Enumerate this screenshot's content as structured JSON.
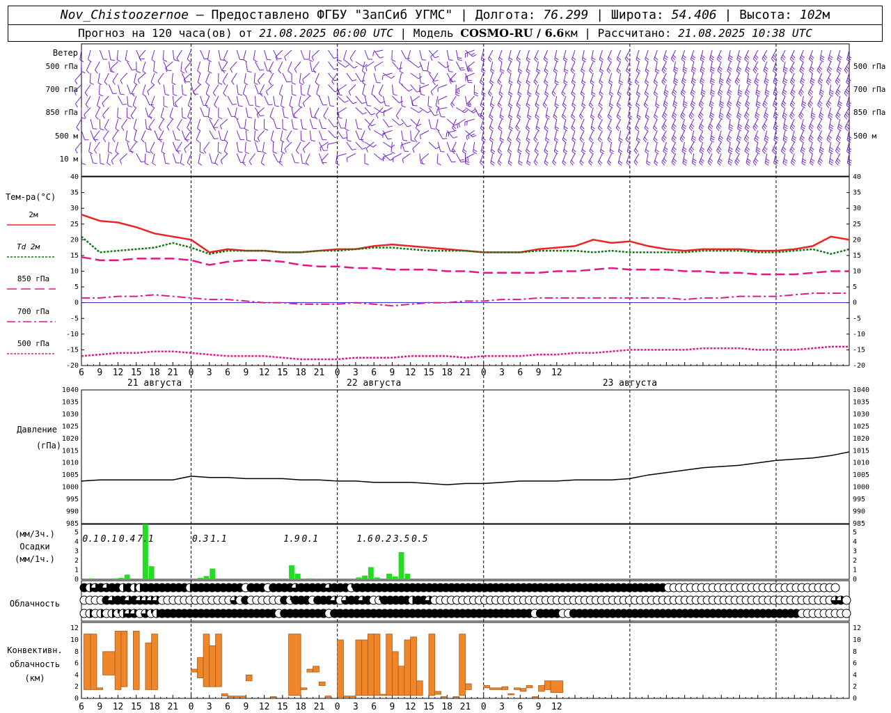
{
  "header": {
    "station": "Nov_Chistoozernoe",
    "provided_by": " – Предоставлено ФГБУ \"ЗапСиб УГМС\" | Долгота: ",
    "lon": "76.299",
    "lat_label": " | Широта: ",
    "lat": "54.406",
    "alt_label": " | Высота: ",
    "alt": "102",
    "alt_unit": "м",
    "forecast_label": "Прогноз на 120 часа(ов) от ",
    "init_time": "21.08.2025 06:00 UTC",
    "model_label": " | Модель ",
    "model": "COSMO-RU / 6.6",
    "model_unit": "км",
    "calc_label": " | Рассчитано: ",
    "calc_time": "21.08.2025 10:38 UTC"
  },
  "panels": {
    "wind": {
      "title": "Ветер",
      "levels": [
        "500 гПа",
        "700 гПа",
        "850 гПа",
        "500 м",
        "10  м"
      ]
    },
    "temp": {
      "title": "Тем-ра(°С)",
      "legend": [
        {
          "label": "2м",
          "color": "#ee2222"
        },
        {
          "label": "Td  2м",
          "color": "#117711"
        },
        {
          "label": "850 гПа",
          "color": "#e01888"
        },
        {
          "label": "700 гПа",
          "color": "#e01888"
        },
        {
          "label": "500 гПа",
          "color": "#e01888"
        }
      ],
      "ticks": [
        "40",
        "35",
        "30",
        "25",
        "20",
        "15",
        "10",
        "5",
        "0",
        "-5",
        "-10",
        "-15",
        "-20"
      ]
    },
    "pressure": {
      "title": "Давление",
      "unit": "(гПа)",
      "ticks": [
        "1040",
        "1035",
        "1030",
        "1025",
        "1020",
        "1015",
        "1010",
        "1005",
        "1000",
        "995",
        "990",
        "985"
      ]
    },
    "precip": {
      "unit_top": "(мм/3ч.)",
      "title": "Осадки",
      "unit_bottom": "(мм/1ч.)",
      "ticks": [
        "5",
        "4",
        "3",
        "2",
        "1",
        "0"
      ]
    },
    "cloud": {
      "title": "Облачность"
    },
    "conv": {
      "title_1": "Конвективн.",
      "title_2": "облачность",
      "title_3": "(км)",
      "ticks": [
        "12",
        "10",
        "8",
        "6",
        "4",
        "2",
        "0"
      ]
    }
  },
  "time_axis": {
    "hour_labels": [
      "6",
      "9",
      "12",
      "15",
      "18",
      "21",
      "0",
      "3",
      "6",
      "9",
      "12",
      "15",
      "18",
      "21",
      "0",
      "3",
      "6",
      "9",
      "12",
      "15",
      "18",
      "21",
      "0",
      "3",
      "6",
      "9",
      "12"
    ],
    "days": [
      "21 августа",
      "22 августа",
      "23 августа"
    ]
  },
  "colors": {
    "wind": "#7722cc",
    "t2m": "#ee2222",
    "td": "#117711",
    "upper": "#e01888",
    "zero": "#2222cc",
    "precip": "#22dd22",
    "conv": "#f0862a"
  },
  "chart_data": [
    {
      "type": "line",
      "name": "temperature",
      "x_hours": [
        0,
        3,
        6,
        9,
        12,
        15,
        18,
        21,
        24,
        27,
        30,
        33,
        36,
        39,
        42,
        45,
        48,
        51,
        54,
        57,
        60,
        63,
        66,
        69,
        72,
        75,
        78,
        81,
        84,
        87,
        90,
        93,
        96,
        99,
        102,
        105,
        108,
        111,
        114,
        117,
        120,
        123,
        126
      ],
      "ylim": [
        -20,
        40
      ],
      "series": [
        {
          "name": "2м",
          "values": [
            28,
            26,
            25.5,
            24,
            22,
            21,
            20,
            16,
            17,
            16.5,
            16.5,
            16,
            16,
            16.5,
            17,
            17,
            18,
            18.5,
            18,
            17.5,
            17,
            16.5,
            16,
            16,
            16,
            17,
            17.5,
            18,
            20,
            19,
            19.5,
            18,
            17,
            16.5,
            17,
            17,
            17,
            16.5,
            16.5,
            17,
            18,
            21,
            20
          ]
        },
        {
          "name": "Td  2м",
          "values": [
            21,
            16,
            16.5,
            17,
            17.5,
            19,
            17.5,
            15.5,
            16.5,
            16.5,
            16.5,
            16,
            16,
            16.5,
            16.5,
            17,
            17.5,
            17.5,
            17,
            16.5,
            16.5,
            16.5,
            16,
            16,
            16,
            16.5,
            16.5,
            16.5,
            16,
            16.5,
            16,
            16,
            16,
            16,
            16.5,
            16.5,
            16.5,
            16,
            16,
            16.5,
            17,
            15.5,
            17
          ]
        },
        {
          "name": "850 гПа",
          "values": [
            14.5,
            13.5,
            13.5,
            14,
            14,
            14,
            13.5,
            12,
            13,
            13.5,
            13.5,
            13,
            12,
            11.5,
            11.5,
            11,
            11,
            10.5,
            10.5,
            10.5,
            10,
            10,
            9.5,
            9.5,
            9.5,
            9.5,
            10,
            10,
            10.5,
            11,
            10.5,
            10.5,
            10.5,
            10,
            10,
            9.5,
            9.5,
            9,
            9,
            9,
            9.5,
            10,
            10
          ]
        },
        {
          "name": "700 гПа",
          "values": [
            1.5,
            1.5,
            2,
            2,
            2.5,
            2,
            1.5,
            1,
            1,
            0.5,
            0,
            0,
            -0.5,
            -0.5,
            -0.5,
            0,
            -0.5,
            -1,
            -0.5,
            0,
            0,
            0.5,
            0.5,
            1,
            1,
            1.5,
            1.5,
            1.5,
            1.5,
            1.5,
            1.5,
            1.5,
            1.5,
            1,
            1.5,
            1.5,
            2,
            2,
            2,
            2.5,
            3,
            3,
            3
          ]
        },
        {
          "name": "500 гПа",
          "values": [
            -17,
            -16.5,
            -16,
            -16,
            -15.5,
            -15.5,
            -16,
            -16.5,
            -17,
            -17,
            -17,
            -17.5,
            -18,
            -18,
            -18,
            -17.5,
            -17.5,
            -17.5,
            -17,
            -17,
            -17,
            -17.5,
            -17,
            -17,
            -17,
            -16.5,
            -16.5,
            -16,
            -16,
            -15.5,
            -15,
            -15,
            -15,
            -15,
            -14.5,
            -14.5,
            -14.5,
            -15,
            -15,
            -15,
            -14.5,
            -14,
            -14
          ]
        }
      ]
    },
    {
      "type": "line",
      "name": "pressure",
      "x_hours": [
        0,
        3,
        6,
        9,
        12,
        15,
        18,
        21,
        24,
        27,
        30,
        33,
        36,
        39,
        42,
        45,
        48,
        51,
        54,
        57,
        60,
        63,
        66,
        69,
        72,
        75,
        78,
        81,
        84,
        87,
        90,
        93,
        96,
        99,
        102,
        105,
        108,
        111,
        114,
        117,
        120,
        123,
        126
      ],
      "ylim": [
        985,
        1040
      ],
      "series": [
        {
          "name": "p",
          "values": [
            1002.5,
            1003,
            1003,
            1003,
            1003,
            1003,
            1004.5,
            1004,
            1004,
            1003.5,
            1003.5,
            1003.5,
            1003,
            1003,
            1002.5,
            1002.5,
            1002,
            1002,
            1002,
            1001.5,
            1001,
            1001.5,
            1001.5,
            1002,
            1002.5,
            1002.5,
            1002.5,
            1003,
            1003,
            1003,
            1003.5,
            1005,
            1006,
            1007,
            1008,
            1008.5,
            1009,
            1010,
            1011,
            1011.5,
            1012,
            1013,
            1014.5
          ]
        }
      ]
    },
    {
      "type": "bar",
      "name": "precipitation",
      "ylim": [
        0,
        5
      ],
      "hourly_bars": [
        {
          "hour": 1.5,
          "value": 0.1
        },
        {
          "hour": 5.5,
          "value": 0.1
        },
        {
          "hour": 6.5,
          "value": 0.15
        },
        {
          "hour": 7.5,
          "value": 0.5
        },
        {
          "hour": 10.5,
          "value": 5.9
        },
        {
          "hour": 11.5,
          "value": 1.4
        },
        {
          "hour": 19.5,
          "value": 0.15
        },
        {
          "hour": 20.5,
          "value": 0.35
        },
        {
          "hour": 21.5,
          "value": 1.15
        },
        {
          "hour": 34.5,
          "value": 1.5
        },
        {
          "hour": 35.5,
          "value": 0.6
        },
        {
          "hour": 37.5,
          "value": 0.1
        },
        {
          "hour": 45.5,
          "value": 0.2
        },
        {
          "hour": 46.5,
          "value": 0.4
        },
        {
          "hour": 47.5,
          "value": 1.3
        },
        {
          "hour": 48.5,
          "value": 0.2
        },
        {
          "hour": 50.5,
          "value": 0.6
        },
        {
          "hour": 51.5,
          "value": 0.3
        },
        {
          "hour": 52.5,
          "value": 2.9
        },
        {
          "hour": 53.5,
          "value": 0.6
        }
      ],
      "totals_3h": [
        {
          "hour": 1.5,
          "label": "0.1"
        },
        {
          "hour": 4.5,
          "label": "0.1"
        },
        {
          "hour": 7.5,
          "label": "0.4"
        },
        {
          "hour": 10.5,
          "label": "7.1"
        },
        {
          "hour": 19.5,
          "label": "0.3"
        },
        {
          "hour": 22.5,
          "label": "1.1"
        },
        {
          "hour": 34.5,
          "label": "1.9"
        },
        {
          "hour": 37.5,
          "label": "0.1"
        },
        {
          "hour": 46.5,
          "label": "1.6"
        },
        {
          "hour": 49.5,
          "label": "0.2"
        },
        {
          "hour": 52.5,
          "label": "3.5"
        },
        {
          "hour": 55.5,
          "label": "0.5"
        }
      ]
    },
    {
      "type": "bar",
      "name": "convective_cloud",
      "ylim": [
        0,
        12
      ],
      "bars": [
        {
          "x0": 0.4,
          "x1": 1.5,
          "base": 1.5,
          "top": 11
        },
        {
          "x0": 1.5,
          "x1": 2.5,
          "base": 1.5,
          "top": 11
        },
        {
          "x0": 2.5,
          "x1": 3.5,
          "base": 1.5,
          "top": 1.8
        },
        {
          "x0": 3.5,
          "x1": 5.5,
          "base": 4,
          "top": 8
        },
        {
          "x0": 5.5,
          "x1": 6.5,
          "base": 1.5,
          "top": 11.5
        },
        {
          "x0": 6.5,
          "x1": 7.5,
          "base": 2,
          "top": 11.5
        },
        {
          "x0": 8.5,
          "x1": 9.5,
          "base": 1.5,
          "top": 11.5
        },
        {
          "x0": 10.5,
          "x1": 11.5,
          "base": 1.5,
          "top": 9.5
        },
        {
          "x0": 11.5,
          "x1": 12.5,
          "base": 1.5,
          "top": 11
        },
        {
          "x0": 18,
          "x1": 19,
          "base": 4.5,
          "top": 5
        },
        {
          "x0": 19,
          "x1": 20,
          "base": 3.5,
          "top": 7
        },
        {
          "x0": 20,
          "x1": 21,
          "base": 2,
          "top": 11
        },
        {
          "x0": 21,
          "x1": 22,
          "base": 2,
          "top": 9
        },
        {
          "x0": 22,
          "x1": 23,
          "base": 2,
          "top": 11
        },
        {
          "x0": 23,
          "x1": 24,
          "base": 0.4,
          "top": 0.8
        },
        {
          "x0": 24,
          "x1": 27,
          "base": 0.2,
          "top": 0.4
        },
        {
          "x0": 27,
          "x1": 28,
          "base": 3,
          "top": 4
        },
        {
          "x0": 31,
          "x1": 32,
          "base": 0.2,
          "top": 0.3
        },
        {
          "x0": 34,
          "x1": 36,
          "base": 0.5,
          "top": 11
        },
        {
          "x0": 36,
          "x1": 37,
          "base": 1.5,
          "top": 1.8
        },
        {
          "x0": 37,
          "x1": 38,
          "base": 4.5,
          "top": 5
        },
        {
          "x0": 38,
          "x1": 39,
          "base": 4.5,
          "top": 5.5
        },
        {
          "x0": 39,
          "x1": 40,
          "base": 2.2,
          "top": 2.8
        },
        {
          "x0": 40,
          "x1": 41,
          "base": 0.2,
          "top": 0.4
        },
        {
          "x0": 42,
          "x1": 43,
          "base": 0.2,
          "top": 10
        },
        {
          "x0": 43,
          "x1": 45,
          "base": 0.2,
          "top": 0.4
        },
        {
          "x0": 45,
          "x1": 46,
          "base": 0.5,
          "top": 10
        },
        {
          "x0": 46,
          "x1": 47,
          "base": 0.5,
          "top": 10
        },
        {
          "x0": 47,
          "x1": 48,
          "base": 0.5,
          "top": 11
        },
        {
          "x0": 48,
          "x1": 49,
          "base": 0.5,
          "top": 11
        },
        {
          "x0": 49,
          "x1": 50,
          "base": 0.5,
          "top": 0.7
        },
        {
          "x0": 50,
          "x1": 51,
          "base": 0.5,
          "top": 11
        },
        {
          "x0": 51,
          "x1": 52,
          "base": 0.5,
          "top": 8
        },
        {
          "x0": 52,
          "x1": 53,
          "base": 0.5,
          "top": 5.5
        },
        {
          "x0": 53,
          "x1": 54,
          "base": 0.5,
          "top": 10
        },
        {
          "x0": 54,
          "x1": 55,
          "base": 0.5,
          "top": 10.5
        },
        {
          "x0": 55,
          "x1": 56,
          "base": 0.5,
          "top": 3
        },
        {
          "x0": 57,
          "x1": 58,
          "base": 0.5,
          "top": 11
        },
        {
          "x0": 58,
          "x1": 59,
          "base": 0.7,
          "top": 1.2
        },
        {
          "x0": 59,
          "x1": 60,
          "base": 0.2,
          "top": 0.3
        },
        {
          "x0": 61,
          "x1": 62,
          "base": 0.2,
          "top": 0.3
        },
        {
          "x0": 62,
          "x1": 63,
          "base": 0.5,
          "top": 11
        },
        {
          "x0": 63,
          "x1": 64,
          "base": 1.5,
          "top": 2.5
        },
        {
          "x0": 66,
          "x1": 67,
          "base": 1.8,
          "top": 2.2
        },
        {
          "x0": 67,
          "x1": 69,
          "base": 1.5,
          "top": 1.8
        },
        {
          "x0": 69,
          "x1": 70,
          "base": 1.5,
          "top": 2
        },
        {
          "x0": 70,
          "x1": 71,
          "base": 0.6,
          "top": 0.8
        },
        {
          "x0": 71,
          "x1": 72,
          "base": 1.5,
          "top": 1.8
        },
        {
          "x0": 72,
          "x1": 73,
          "base": 1.2,
          "top": 1.7
        },
        {
          "x0": 73,
          "x1": 74,
          "base": 1.8,
          "top": 2.2
        },
        {
          "x0": 74,
          "x1": 75,
          "base": 0.2,
          "top": 0.3
        },
        {
          "x0": 75,
          "x1": 76,
          "base": 1.2,
          "top": 2.2
        },
        {
          "x0": 76,
          "x1": 77,
          "base": 1.5,
          "top": 3
        },
        {
          "x0": 77,
          "x1": 79,
          "base": 1,
          "top": 3
        }
      ]
    },
    {
      "type": "table",
      "name": "cloud_cover_symbols",
      "note": "octa codes per hour (0=clear,2=quarter,4=half,6=three-quarter,8=overcast); rows top-to-bottom",
      "rows": [
        "8468688484488888888488888888808880888868888868882888888888888888888888888888888888888888888888888888888880000000000000000000000000000000",
        "0000868868666600000000000006080000008288808886068868028888848860000000000000000000000000000000000000000000000000000000000000000000000006600",
        "0404042466062488888888888888888888808888888808888888888888888888888888888888888880888800888888888888888888888888888888888888888880000000000"
      ]
    }
  ]
}
